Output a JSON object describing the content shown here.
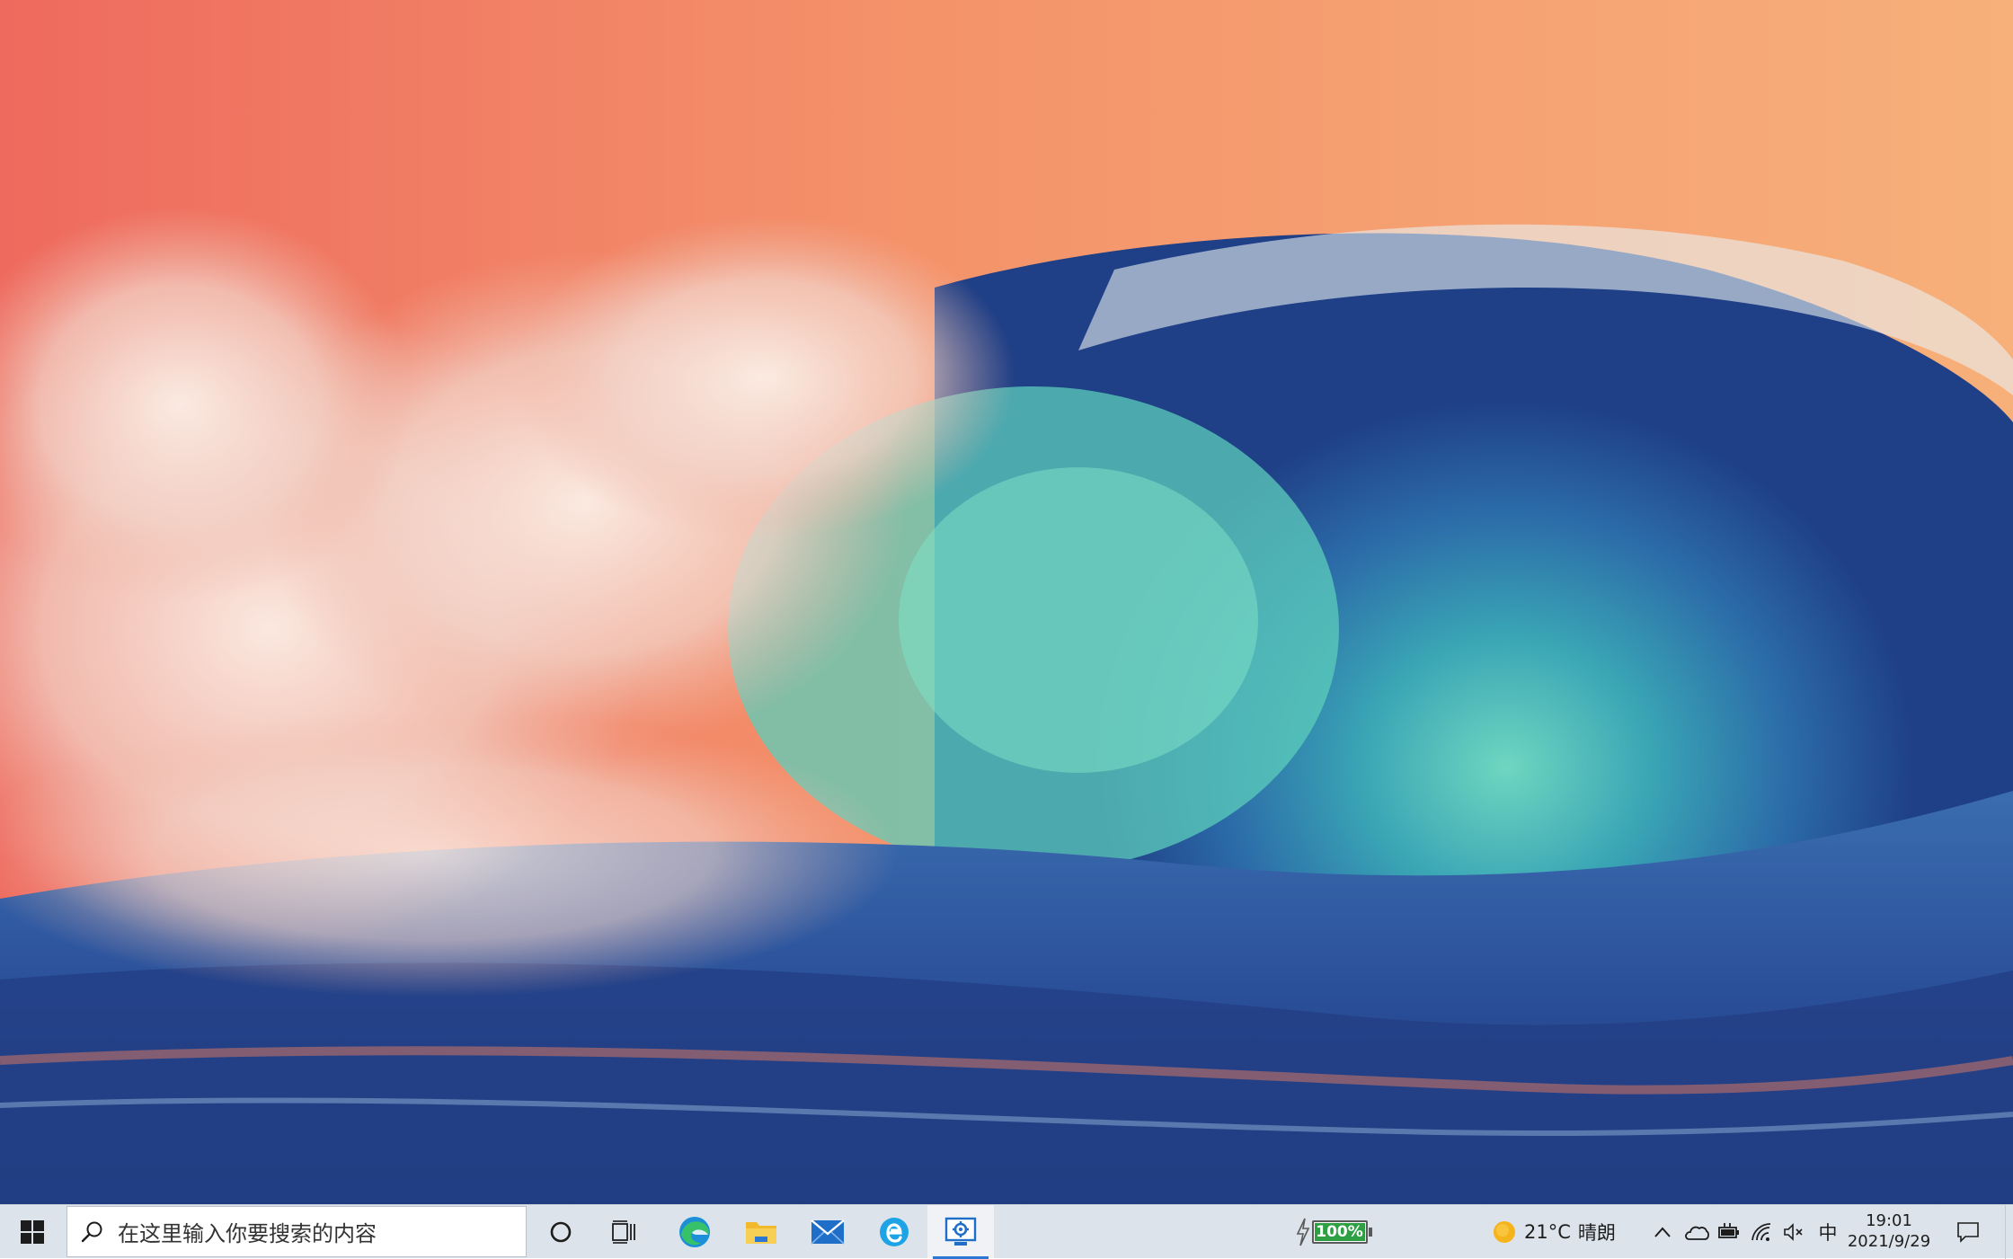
{
  "desktop": {
    "wallpaper": "ocean-wave-painting"
  },
  "taskbar": {
    "background": "#dde3ea",
    "search": {
      "placeholder": "在这里输入你要搜索的内容",
      "icon": "search-icon"
    },
    "pinned_apps": [
      {
        "name": "edge",
        "icon": "edge-icon"
      },
      {
        "name": "file-explorer",
        "icon": "folder-icon"
      },
      {
        "name": "mail",
        "icon": "mail-icon"
      },
      {
        "name": "internet-explorer",
        "icon": "ie-icon"
      },
      {
        "name": "control-panel",
        "icon": "control-panel-icon",
        "active": true
      }
    ],
    "battery": {
      "percent_label": "100%",
      "level": 1.0,
      "charging": true
    },
    "weather": {
      "temperature": "21°C",
      "condition": "晴朗",
      "icon": "sun-icon"
    },
    "tray": {
      "ime": "中",
      "icons": [
        "chevron-up-icon",
        "onedrive-icon",
        "power-icon",
        "wifi-icon",
        "volume-icon"
      ]
    },
    "clock": {
      "time": "19:01",
      "date": "2021/9/29"
    }
  },
  "colors": {
    "accent": "#2a78d4",
    "battery_green": "#2ea043"
  }
}
